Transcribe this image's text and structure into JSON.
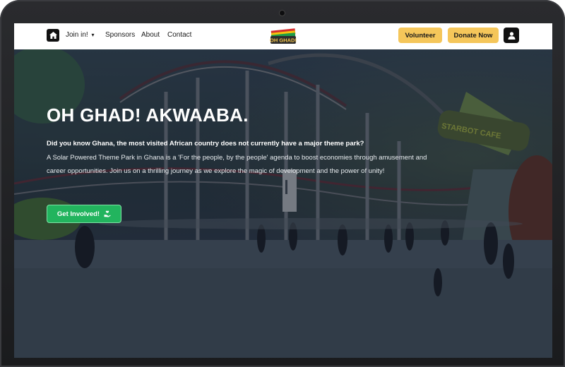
{
  "nav": {
    "join_label": "Join in!",
    "join_caret": "▾",
    "sponsors_label": "Sponsors",
    "about_label": "About",
    "contact_label": "Contact",
    "volunteer_label": "Volunteer",
    "donate_label": "Donate Now",
    "logo_text": "OH GHAD!"
  },
  "hero": {
    "title": "OH GHAD! AKWAABA.",
    "lead": "Did you know Ghana, the most visited African country does not currently have a major theme park?",
    "body": "A Solar Powered Theme Park in Ghana is a 'For the people, by the people' agenda to boost economies through amusement and career opportunities. Join us on a thrilling journey as we explore the magic of development and the power of unity!",
    "cta_label": "Get Involved!",
    "cafe_sign": "STARBOT CAFE"
  },
  "colors": {
    "accent_yellow": "#f5c65a",
    "cta_green": "#22b45e",
    "nav_dark": "#111111"
  },
  "icons": [
    "home-icon",
    "chevron-down-icon",
    "user-icon",
    "hand-heart-icon"
  ]
}
